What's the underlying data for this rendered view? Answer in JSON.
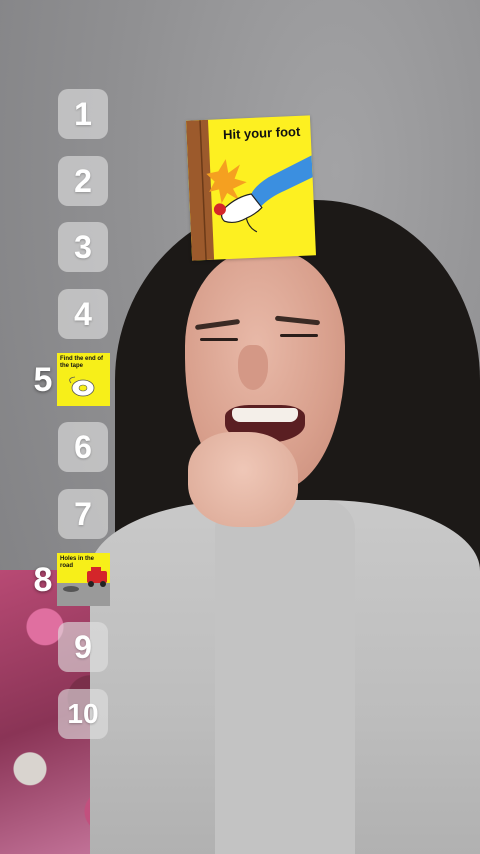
{
  "top_card": {
    "caption": "Hit your foot",
    "icon": "foot-hitting-door-illustration"
  },
  "slots": [
    {
      "number": "1",
      "state": "empty"
    },
    {
      "number": "2",
      "state": "empty"
    },
    {
      "number": "3",
      "state": "empty"
    },
    {
      "number": "4",
      "state": "empty"
    },
    {
      "number": "5",
      "state": "filled",
      "caption": "Find the end of the tape",
      "icon": "tape-roll-illustration"
    },
    {
      "number": "6",
      "state": "empty"
    },
    {
      "number": "7",
      "state": "empty"
    },
    {
      "number": "8",
      "state": "filled",
      "caption": "Holes in the road",
      "icon": "car-pothole-illustration"
    },
    {
      "number": "9",
      "state": "empty"
    },
    {
      "number": "10",
      "state": "empty"
    }
  ],
  "colors": {
    "card_yellow": "#fdf021",
    "slot_fill": "rgba(225,225,225,0.62)",
    "number_text": "#ffffff"
  }
}
